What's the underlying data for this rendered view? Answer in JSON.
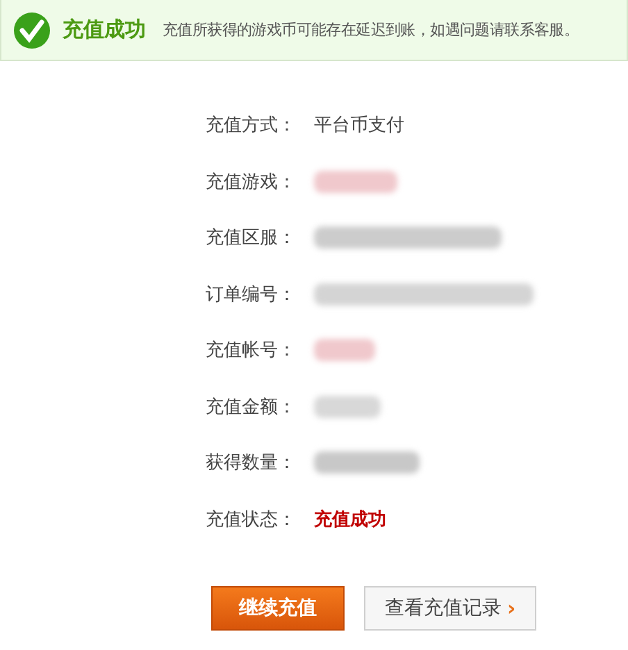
{
  "banner": {
    "title": "充值成功",
    "message": "充值所获得的游戏币可能存在延迟到账，如遇问题请联系客服。"
  },
  "details": [
    {
      "label": "充值方式：",
      "kind": "text",
      "value": "平台币支付"
    },
    {
      "label": "充值游戏：",
      "kind": "redacted",
      "color": "#f0c8cc"
    },
    {
      "label": "充值区服：",
      "kind": "redacted",
      "color": "#cccccc"
    },
    {
      "label": "订单编号：",
      "kind": "redacted",
      "color": "#d4d4d4"
    },
    {
      "label": "充值帐号：",
      "kind": "redacted",
      "color": "#f0c8cc"
    },
    {
      "label": "充值金额：",
      "kind": "redacted",
      "color": "#d8d8d8"
    },
    {
      "label": "获得数量：",
      "kind": "redacted",
      "color": "#c8c8c8"
    },
    {
      "label": "充值状态：",
      "kind": "status",
      "value": "充值成功"
    }
  ],
  "buttons": [
    {
      "label": "继续充值",
      "kind": "primary"
    },
    {
      "label": "查看充值记录",
      "kind": "secondary",
      "arrow": "›"
    }
  ]
}
